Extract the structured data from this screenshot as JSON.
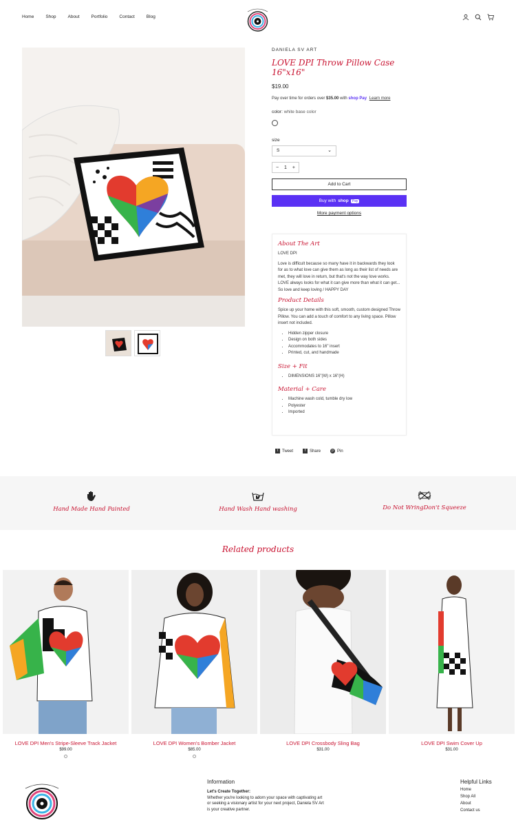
{
  "header": {
    "nav": [
      "Home",
      "Shop",
      "About",
      "Portfolio",
      "Contact",
      "Blog"
    ],
    "logo_text": "DANIELA SV ART",
    "icons": [
      "account-icon",
      "search-icon",
      "cart-icon"
    ]
  },
  "product": {
    "vendor": "DANIELA SV ART",
    "title": "LOVE DPI Throw Pillow Case 16\"x16\"",
    "price": "$19.00",
    "pay_over_prefix": "Pay over time for orders over",
    "pay_over_amount": "$35.00",
    "pay_over_with": "with",
    "shop_pay": "shop Pay",
    "learn_more": "Learn more",
    "color_label": "color:",
    "color_value": "white base color",
    "size_label": "size",
    "size_value": "S",
    "quantity": "1",
    "add_to_cart": "Add to Cart",
    "buy_with": "Buy with",
    "shop_word": "shop",
    "pay_word": "Pay",
    "more_options": "More payment options"
  },
  "description": {
    "about_heading": "About The Art",
    "about_title": "LOVE DPI",
    "about_body": "Love is difficult because so many have it in backwards they look for as to what love can give them as long as their list of needs are met, they will love in return, but that's not the way love works. LOVE always looks for what it can give more than what it can get... So love and keep loving / HAPPY DAY",
    "details_heading": "Product Details",
    "details_body": "Spice up your home with this soft, smooth, custom designed Throw Pillow. You can add a touch of comfort to any living space. Pillow insert not included.",
    "details_list": [
      "Hidden zipper closure",
      "Design on both sides",
      "Accommodates to 16\" insert",
      "Printed, cut, and handmade"
    ],
    "size_heading": "Size + Fit",
    "size_list": [
      "DIMENSIONS 16\"(W) x 16\"(H)"
    ],
    "care_heading": "Material + Care",
    "care_list": [
      "Machine wash cold, tumble dry low",
      "Polyester",
      "Imported"
    ]
  },
  "share": {
    "tweet": "Tweet",
    "share": "Share",
    "pin": "Pin"
  },
  "features": [
    {
      "icon": "hand-icon",
      "label": "Hand Made Hand Painted"
    },
    {
      "icon": "hand-wash-icon",
      "label": "Hand Wash Hand washing"
    },
    {
      "icon": "no-wring-icon",
      "label": "Do Not WringDon't Squeeze"
    }
  ],
  "related_heading": "Related products",
  "related": [
    {
      "name": "LOVE DPI Men's Stripe-Sleeve Track Jacket",
      "price": "$99.00"
    },
    {
      "name": "LOVE DPI Women's Bomber Jacket",
      "price": "$85.00"
    },
    {
      "name": "LOVE DPI Crossbody Sling Bag",
      "price": "$31.00"
    },
    {
      "name": "LOVE DPI Swim Cover Up",
      "price": "$31.00"
    }
  ],
  "footer": {
    "info_heading": "Information",
    "info_bold": "Let's Create Together:",
    "info_text": "Whether you're looking to adorn your space with captivating art or seeking a visionary artist for your next project, Daniela SV Art is your creative partner.",
    "links_heading": "Helpful Links",
    "links": [
      "Home",
      "Shop All",
      "About",
      "Contact us"
    ]
  },
  "colors": {
    "accent": "#c8102e",
    "shop_pay": "#5a31f4"
  }
}
